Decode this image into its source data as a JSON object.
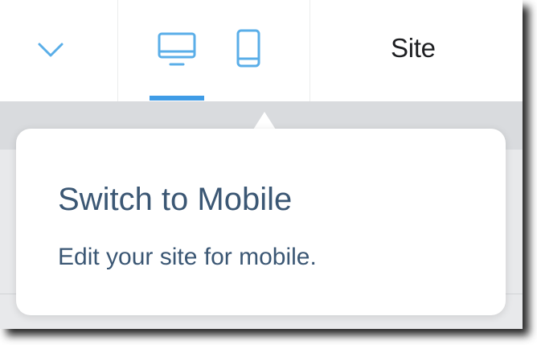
{
  "toolbar": {
    "site_label": "Site",
    "active_view": "desktop"
  },
  "tooltip": {
    "title": "Switch to Mobile",
    "description": "Edit your site for mobile."
  },
  "colors": {
    "accent": "#3f9ce6",
    "icon": "#5aaee8",
    "text": "#3b5774"
  },
  "icons": {
    "chevron": "chevron-down-icon",
    "desktop": "desktop-icon",
    "mobile": "mobile-icon"
  }
}
